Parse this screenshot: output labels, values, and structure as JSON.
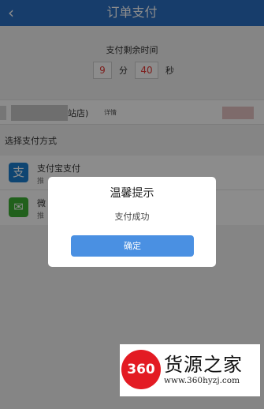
{
  "navbar": {
    "back_icon": "chevron-left-icon",
    "title": "订单支付"
  },
  "timer": {
    "label": "支付剩余时间",
    "minutes": "9",
    "minutes_unit": "分",
    "seconds": "40",
    "seconds_unit": "秒"
  },
  "shop": {
    "name_suffix": "站店)",
    "detail_label": "详情"
  },
  "payment": {
    "section_title": "选择支付方式",
    "methods": [
      {
        "icon": "alipay-icon",
        "glyph": "支",
        "name": "支付宝支付",
        "desc": "推"
      },
      {
        "icon": "wechat-pay-icon",
        "glyph": "✉",
        "name": "微",
        "desc": "推"
      }
    ]
  },
  "dialog": {
    "title": "温馨提示",
    "message": "支付成功",
    "confirm": "确定"
  },
  "watermark": {
    "seal": "360",
    "text": "货源之家",
    "url": "www.360hyzj.com"
  },
  "colors": {
    "navbar": "#2b6fc4",
    "timer_digits": "#e53935",
    "confirm_button": "#4a90e2",
    "alipay": "#1a7fd0",
    "wechat": "#3cb034",
    "seal": "#e31b23"
  }
}
